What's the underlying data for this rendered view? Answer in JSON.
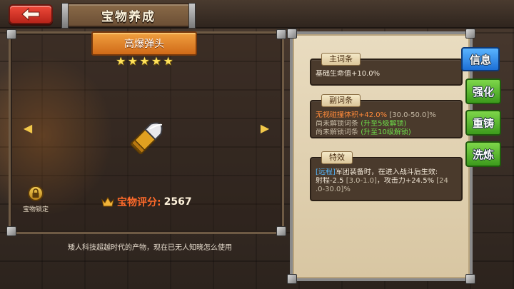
{
  "header": {
    "title": "宝物养成",
    "back_icon": "back-arrow-icon"
  },
  "item": {
    "name": "高爆弹头",
    "stars": 5,
    "star_glyph": "★",
    "icon": "bullet-icon",
    "lock_label": "宝物锁定",
    "lock_icon": "lock-icon",
    "score_label": "宝物评分:",
    "score_value": "2567",
    "crown_icon": "crown-icon",
    "description": "矮人科技超越时代的产物，现在已无人知晓怎么使用"
  },
  "nav": {
    "prev_glyph": "◀",
    "next_glyph": "▶"
  },
  "sections": {
    "main": {
      "tag": "主词条",
      "line1": "基础生命值+10.0%"
    },
    "sub": {
      "tag": "副词条",
      "line1_main": "无视碰撞体积+42.0%",
      "line1_range": "[30.0-50.0]%",
      "line2_main": "尚未解锁词条",
      "line2_hint": "(升至5级解锁)",
      "line3_main": "尚未解锁词条",
      "line3_hint": "(升至10级解锁)"
    },
    "special": {
      "tag": "特效",
      "line1_tag": "[远程]",
      "line1_text": "军团装备时，在进入战斗后生效:",
      "line2_text": "射程-2.5",
      "line2_range": "[3.0-1.0]",
      "line2_text2": "，攻击力+24.5%",
      "line2_range2": "[24",
      "line3_text": ".0-30.0]%"
    }
  },
  "tabs": [
    {
      "label": "信息"
    },
    {
      "label": "强化"
    },
    {
      "label": "重铸"
    },
    {
      "label": "洗炼"
    }
  ],
  "colors": {
    "tab_active": "#1c6fd6",
    "tab_inactive": "#3c9a1c",
    "score": "#ff6a2a",
    "unlock_hint": "#6edc4a"
  }
}
